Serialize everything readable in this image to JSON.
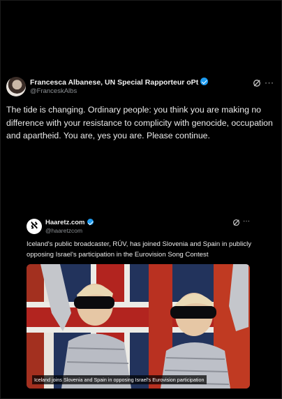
{
  "post": {
    "author_name": "Francesca Albanese, UN Special Rapporteur oPt",
    "handle": "@FranceskAlbs",
    "text": "The tide is changing. Ordinary people: you think you are making no difference with your resistance to complicity with genocide, occupation and apartheid. You are, yes you are. Please continue.",
    "more_glyph": "···",
    "verified_color": "#1d9bf0"
  },
  "quoted_post": {
    "author_name": "Haaretz.com",
    "handle": "@haaretzcom",
    "avatar_letter": "ℵ",
    "text": "Iceland's public broadcaster, RÚV, has joined Slovenia and Spain in publicly opposing Israel's participation in the Eurovision Song Contest",
    "more_glyph": "···",
    "media_caption": "Iceland joins Slovenia and Spain in opposing Israel's Eurovision participation"
  }
}
